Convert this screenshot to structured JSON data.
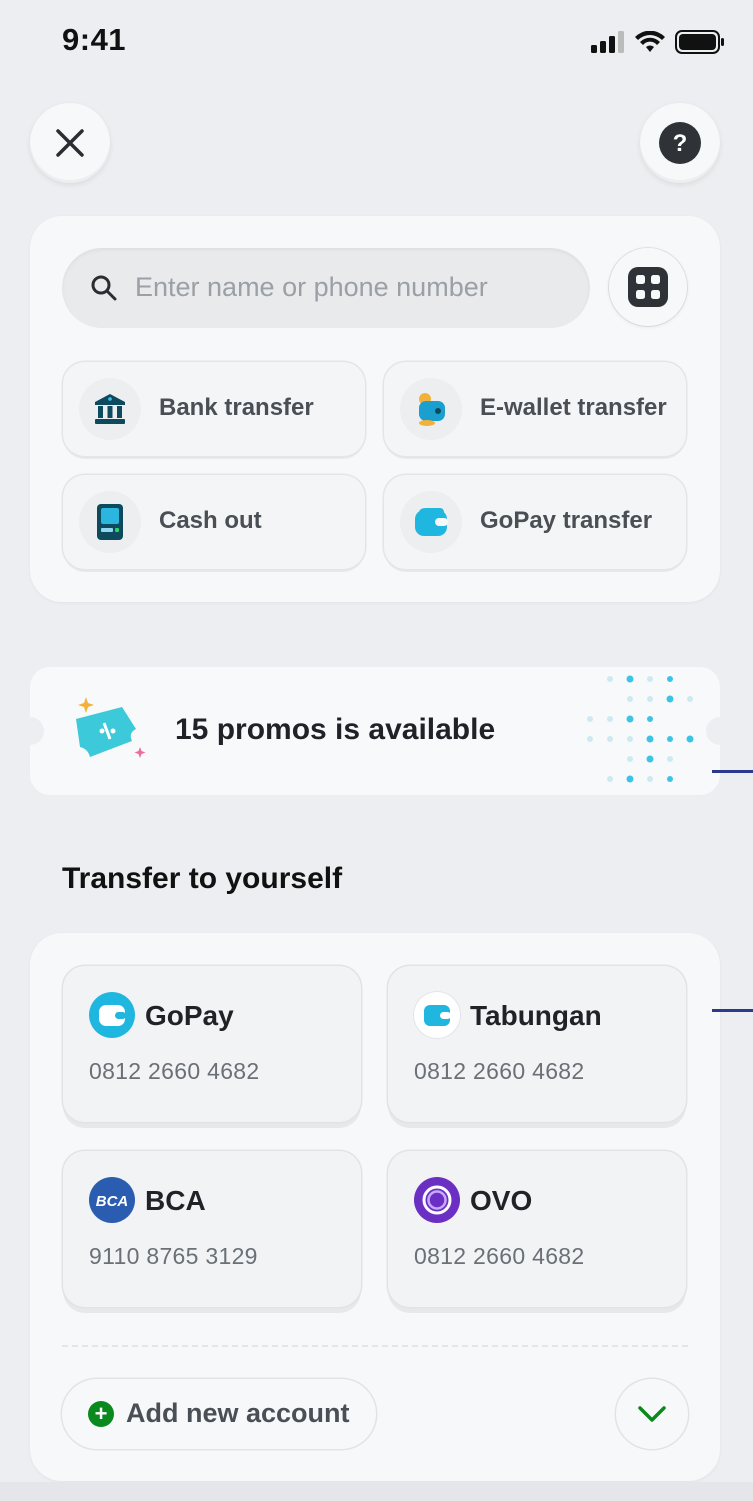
{
  "status_bar": {
    "time": "9:41"
  },
  "search": {
    "placeholder": "Enter name or phone number"
  },
  "actions": [
    {
      "label": "Bank transfer",
      "icon": "bank-icon"
    },
    {
      "label": "E-wallet transfer",
      "icon": "ewallet-icon"
    },
    {
      "label": "Cash out",
      "icon": "atm-icon"
    },
    {
      "label": "GoPay transfer",
      "icon": "gopay-wallet-icon"
    }
  ],
  "promo": {
    "text": "15 promos is available"
  },
  "self_transfer": {
    "title": "Transfer to yourself",
    "accounts": [
      {
        "name": "GoPay",
        "number": "0812 2660 4682",
        "icon": "gopay-logo-icon"
      },
      {
        "name": "Tabungan",
        "number": "0812 2660 4682",
        "icon": "tabungan-logo-icon"
      },
      {
        "name": "BCA",
        "number": "9110 8765 3129",
        "icon": "bca-logo-icon",
        "logo_text": "BCA"
      },
      {
        "name": "OVO",
        "number": "0812 2660 4682",
        "icon": "ovo-logo-icon"
      }
    ],
    "add_label": "Add new account"
  },
  "colors": {
    "accent_green": "#0a8a1e",
    "gopay_blue": "#1fb7e0",
    "bca_blue": "#2a5db0",
    "ovo_purple": "#6b2fc4"
  }
}
